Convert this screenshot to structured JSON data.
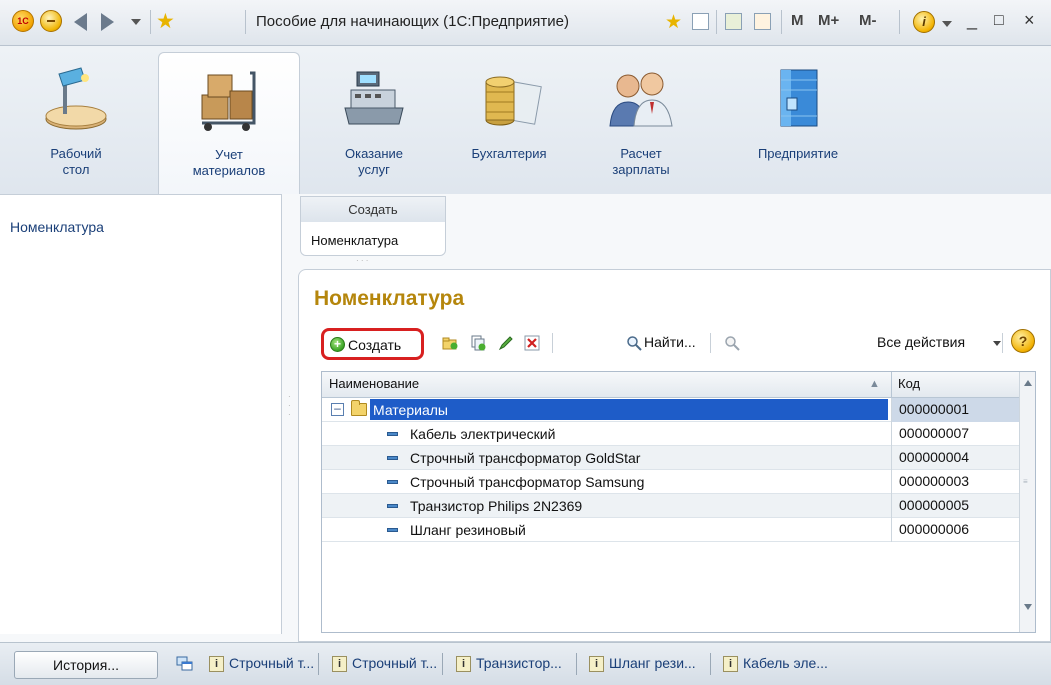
{
  "window": {
    "title": "Пособие для начинающих  (1С:Предприятие)",
    "logo_text": "1C",
    "mem_buttons": [
      "M",
      "M+",
      "M-"
    ],
    "info_glyph": "i",
    "controls": [
      "_",
      "□",
      "×"
    ]
  },
  "sections": [
    {
      "label": "Рабочий\nстол",
      "icon": "desk-lamp-icon",
      "active": false
    },
    {
      "label": "Учет\nматериалов",
      "icon": "boxes-cart-icon",
      "active": true
    },
    {
      "label": "Оказание\nуслуг",
      "icon": "cash-register-icon",
      "active": false
    },
    {
      "label": "Бухгалтерия",
      "icon": "coins-stack-icon",
      "active": false
    },
    {
      "label": "Расчет\nзарплаты",
      "icon": "people-icon",
      "active": false
    },
    {
      "label": "Предприятие",
      "icon": "building-icon",
      "active": false
    }
  ],
  "navigation": {
    "items": [
      "Номенклатура"
    ]
  },
  "actions": {
    "create_header": "Создать",
    "items": [
      "Номенклатура"
    ]
  },
  "form": {
    "title": "Номенклатура",
    "toolbar": {
      "create_label": "Создать",
      "find_label": "Найти...",
      "all_actions_label": "Все действия",
      "help_glyph": "?"
    },
    "table": {
      "columns": [
        "Наименование",
        "Код"
      ],
      "rows": [
        {
          "name": "Материалы",
          "code": "000000001",
          "type": "folder",
          "selected": true
        },
        {
          "name": "Кабель электрический",
          "code": "000000007",
          "type": "item",
          "selected": false
        },
        {
          "name": "Строчный трансформатор GoldStar",
          "code": "000000004",
          "type": "item",
          "selected": false
        },
        {
          "name": "Строчный трансформатор Samsung",
          "code": "000000003",
          "type": "item",
          "selected": false
        },
        {
          "name": "Транзистор Philips 2N2369",
          "code": "000000005",
          "type": "item",
          "selected": false
        },
        {
          "name": "Шланг резиновый",
          "code": "000000006",
          "type": "item",
          "selected": false
        }
      ]
    }
  },
  "taskbar": {
    "history_label": "История...",
    "items": [
      "Строчный т...",
      "Строчный т...",
      "Транзистор...",
      "Шланг рези...",
      "Кабель эле..."
    ],
    "item_glyph": "i"
  },
  "colors": {
    "form_title": "#b5860c",
    "selection": "#1e5cc8",
    "highlight_frame": "#d82020",
    "link": "#1a3f78"
  }
}
